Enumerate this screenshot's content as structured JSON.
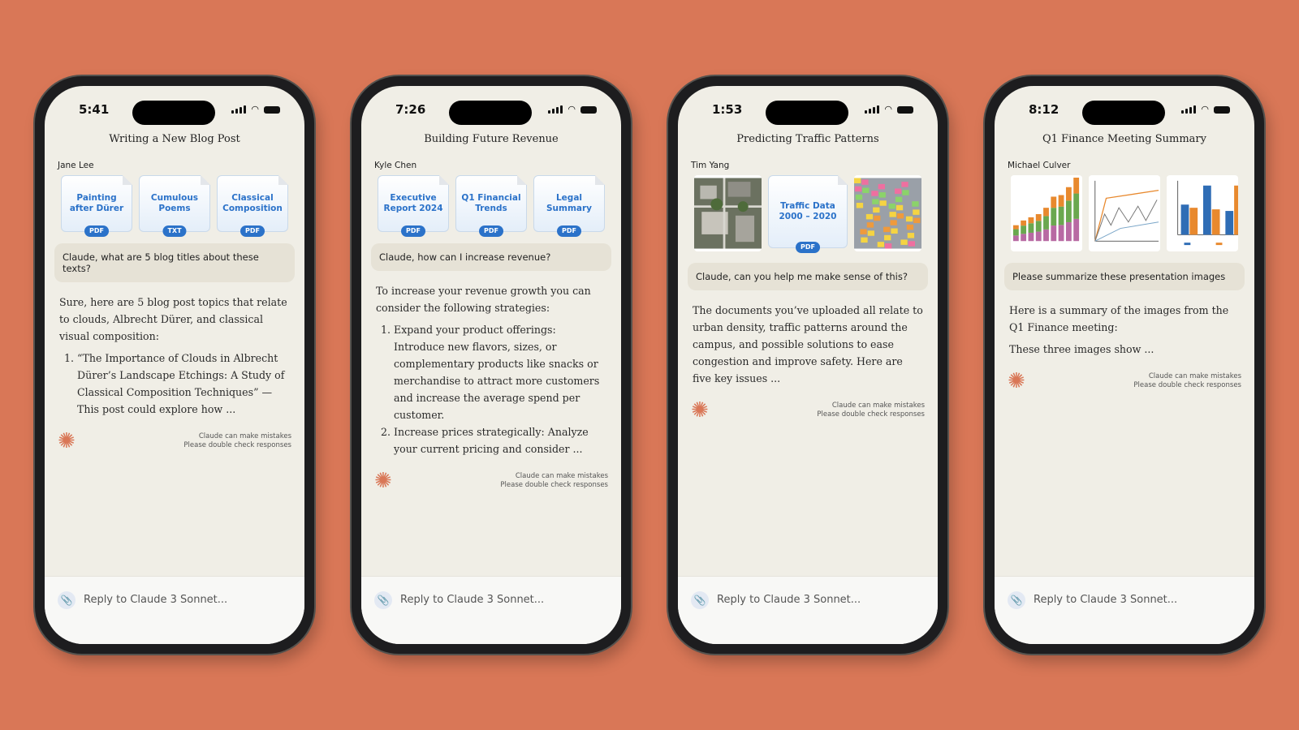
{
  "colors": {
    "background": "#d97757",
    "accent": "#d97757",
    "file_blue": "#2b72c9"
  },
  "reply_placeholder": "Reply to Claude 3 Sonnet...",
  "disclaimer": [
    "Claude can make mistakes",
    "Please double check responses"
  ],
  "phones": [
    {
      "time": "5:41",
      "title": "Writing a New Blog Post",
      "user": "Jane Lee",
      "attachments": [
        {
          "name": "Painting after Dürer",
          "type": "PDF"
        },
        {
          "name": "Cumulous Poems",
          "type": "TXT"
        },
        {
          "name": "Classical Composition",
          "type": "PDF"
        }
      ],
      "question": "Claude, what are 5 blog titles about these texts?",
      "answer_intro": "Sure, here are 5 blog post topics that relate to clouds, Albrecht Dürer, and classical visual composition:",
      "answer_list": [
        "“The Importance of Clouds in Albrecht Dürer’s Landscape Etchings: A Study of Classical Composition Techniques” — This post could explore how ..."
      ]
    },
    {
      "time": "7:26",
      "title": "Building Future Revenue",
      "user": "Kyle Chen",
      "attachments": [
        {
          "name": "Executive Report 2024",
          "type": "PDF"
        },
        {
          "name": "Q1 Financial Trends",
          "type": "PDF"
        },
        {
          "name": "Legal Summary",
          "type": "PDF"
        }
      ],
      "question": "Claude, how can I increase revenue?",
      "answer_intro": "To increase your revenue growth you can consider the following strategies:",
      "answer_list": [
        "Expand your product offerings: Introduce new flavors, sizes, or complementary products like snacks or merchandise to attract more customers and increase the average spend per customer.",
        "Increase prices strategically: Analyze your current pricing and consider ..."
      ]
    },
    {
      "time": "1:53",
      "title": "Predicting Traffic Patterns",
      "user": "Tim Yang",
      "attachments": [
        {
          "name": "aerial-photo",
          "type": "image"
        },
        {
          "name": "Traffic Data 2000 – 2020",
          "type": "PDF"
        },
        {
          "name": "sticky-notes-photo",
          "type": "image"
        }
      ],
      "question": "Claude, can you help me make sense of this?",
      "answer_intro": "The documents you’ve uploaded all relate to urban density, traffic patterns around the campus, and possible solutions to ease congestion and improve safety. Here are five key issues ...",
      "answer_list": []
    },
    {
      "time": "8:12",
      "title": "Q1 Finance Meeting Summary",
      "user": "Michael Culver",
      "attachments": [
        {
          "name": "stacked-bar-chart",
          "type": "image"
        },
        {
          "name": "line-chart",
          "type": "image"
        },
        {
          "name": "bar-chart",
          "type": "image"
        }
      ],
      "question": "Please summarize these presentation images",
      "answer_intro": "Here is a summary of the images from the Q1 Finance meeting:",
      "answer_extra": "These three images show ...",
      "answer_list": []
    }
  ]
}
